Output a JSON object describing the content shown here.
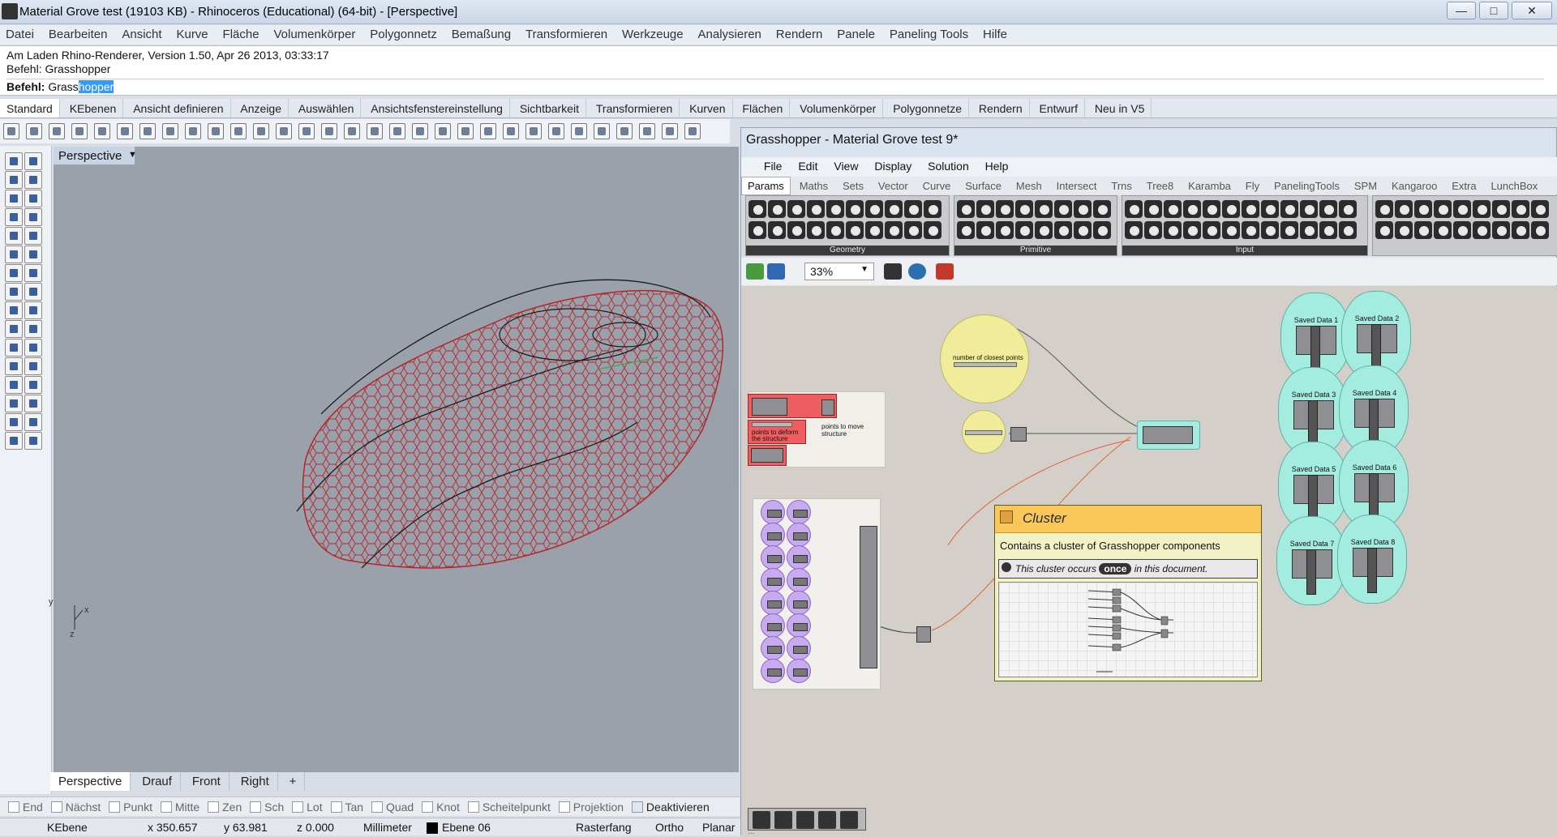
{
  "window": {
    "title": "Material Grove test (19103 KB) - Rhinoceros (Educational) (64-bit) - [Perspective]"
  },
  "menu": [
    "Datei",
    "Bearbeiten",
    "Ansicht",
    "Kurve",
    "Fläche",
    "Volumenkörper",
    "Polygonnetz",
    "Bemaßung",
    "Transformieren",
    "Werkzeuge",
    "Analysieren",
    "Rendern",
    "Panele",
    "Paneling Tools",
    "Hilfe"
  ],
  "command": {
    "history1": "Am Laden Rhino-Renderer, Version 1.50, Apr 26 2013, 03:33:17",
    "history2": "Befehl: Grasshopper",
    "prompt_label": "Befehl:",
    "prompt_typed": "Grass",
    "prompt_autocomplete": "hopper"
  },
  "tabs": [
    "Standard",
    "KEbenen",
    "Ansicht definieren",
    "Anzeige",
    "Auswählen",
    "Ansichtsfenstereinstellung",
    "Sichtbarkeit",
    "Transformieren",
    "Kurven",
    "Flächen",
    "Volumenkörper",
    "Polygonnetze",
    "Rendern",
    "Entwurf",
    "Neu in V5"
  ],
  "viewport": {
    "label": "Perspective",
    "axis_y": "y",
    "axis_x": "x",
    "axis_z": "z"
  },
  "viewport_tabs": [
    "Perspective",
    "Drauf",
    "Front",
    "Right",
    "+"
  ],
  "snaps": [
    {
      "label": "End",
      "on": false
    },
    {
      "label": "Nächst",
      "on": false
    },
    {
      "label": "Punkt",
      "on": false
    },
    {
      "label": "Mitte",
      "on": false
    },
    {
      "label": "Zen",
      "on": false
    },
    {
      "label": "Sch",
      "on": false
    },
    {
      "label": "Lot",
      "on": false
    },
    {
      "label": "Tan",
      "on": false
    },
    {
      "label": "Quad",
      "on": false
    },
    {
      "label": "Knot",
      "on": false
    },
    {
      "label": "Scheitelpunkt",
      "on": false
    },
    {
      "label": "Projektion",
      "on": false
    },
    {
      "label": "Deaktivieren",
      "on": true
    }
  ],
  "status": {
    "layer_label": "KEbene",
    "x": "x 350.657",
    "y": "y 63.981",
    "z": "z 0.000",
    "units": "Millimeter",
    "layer": "Ebene 06",
    "grid": "Rasterfang",
    "ortho": "Ortho",
    "planar": "Planar"
  },
  "gh": {
    "title": "Grasshopper - Material Grove test 9*",
    "menu": [
      "File",
      "Edit",
      "View",
      "Display",
      "Solution",
      "Help"
    ],
    "tabs": [
      "Params",
      "Maths",
      "Sets",
      "Vector",
      "Curve",
      "Surface",
      "Mesh",
      "Intersect",
      "Trns",
      "Tree8",
      "Karamba",
      "Fly",
      "PanelingTools",
      "SPM",
      "Kangaroo",
      "Extra",
      "LunchBox"
    ],
    "groups": [
      "Geometry",
      "Primitive",
      "Input"
    ],
    "zoom": "33%",
    "slider1_label": "number of closest points",
    "red_label1": "points to deform the structure",
    "red_label2": "points to move structure",
    "saved": [
      "Saved Data 1",
      "Saved Data 2",
      "Saved Data 3",
      "Saved Data 4",
      "Saved Data 5",
      "Saved Data 6",
      "Saved Data 7",
      "Saved Data 8"
    ],
    "tooltip": {
      "title": "Cluster",
      "desc": "Contains a cluster of Grasshopper components",
      "occ_pre": "This cluster occurs",
      "occ_badge": "once",
      "occ_post": "in this document."
    },
    "bottom": "..."
  },
  "colors": {
    "mesh": "#b3262b",
    "curve": "#1a1a1a",
    "gh_canvas": "#d4d0c9",
    "tooltip_head": "#f9c859"
  }
}
